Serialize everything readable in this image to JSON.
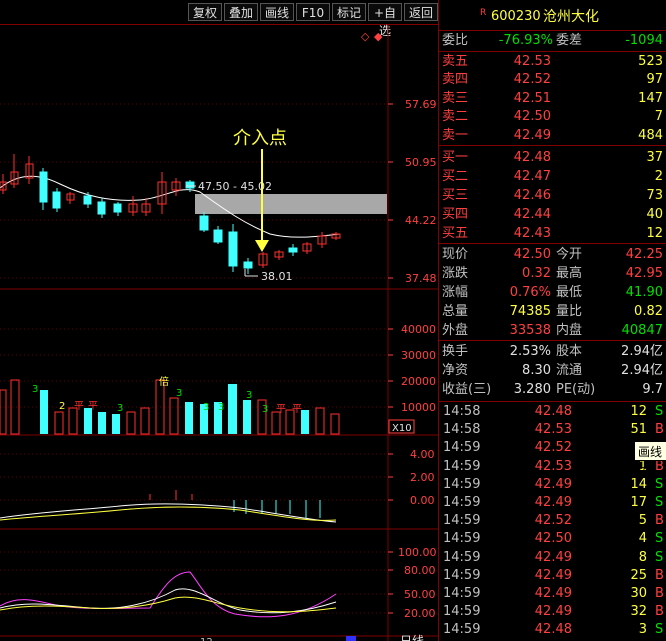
{
  "toolbar": {
    "buttons": [
      "复权",
      "叠加",
      "画线",
      "F10",
      "标记",
      "+自选",
      "返回"
    ]
  },
  "stock": {
    "flag": "R",
    "code": "600230",
    "name": "沧州大化"
  },
  "order_book": {
    "weibi_label": "委比",
    "weibi": "-76.93%",
    "weicha_label": "委差",
    "weicha": "-1094",
    "asks": [
      {
        "label": "卖五",
        "price": "42.53",
        "vol": "523"
      },
      {
        "label": "卖四",
        "price": "42.52",
        "vol": "97"
      },
      {
        "label": "卖三",
        "price": "42.51",
        "vol": "147"
      },
      {
        "label": "卖二",
        "price": "42.50",
        "vol": "7"
      },
      {
        "label": "卖一",
        "price": "42.49",
        "vol": "484"
      }
    ],
    "bids": [
      {
        "label": "买一",
        "price": "42.48",
        "vol": "37"
      },
      {
        "label": "买二",
        "price": "42.47",
        "vol": "2"
      },
      {
        "label": "买三",
        "price": "42.46",
        "vol": "73"
      },
      {
        "label": "买四",
        "price": "42.44",
        "vol": "40"
      },
      {
        "label": "买五",
        "price": "42.43",
        "vol": "12"
      }
    ]
  },
  "quote": [
    {
      "l1": "现价",
      "v1": "42.50",
      "c1": "red",
      "l2": "今开",
      "v2": "42.25",
      "c2": "red"
    },
    {
      "l1": "涨跌",
      "v1": "0.32",
      "c1": "red",
      "l2": "最高",
      "v2": "42.95",
      "c2": "red"
    },
    {
      "l1": "涨幅",
      "v1": "0.76%",
      "c1": "red",
      "l2": "最低",
      "v2": "41.90",
      "c2": "green"
    },
    {
      "l1": "总量",
      "v1": "74385",
      "c1": "yellow",
      "l2": "量比",
      "v2": "0.82",
      "c2": "yellow"
    },
    {
      "l1": "外盘",
      "v1": "33538",
      "c1": "red",
      "l2": "内盘",
      "v2": "40847",
      "c2": "green"
    }
  ],
  "stats": [
    {
      "l1": "换手",
      "v1": "2.53%",
      "l2": "股本",
      "v2": "2.94亿"
    },
    {
      "l1": "净资",
      "v1": "8.30",
      "l2": "流通",
      "v2": "2.94亿"
    },
    {
      "l1": "收益(三)",
      "v1": "3.280",
      "l2": "PE(动)",
      "v2": "9.7"
    }
  ],
  "ticks": [
    {
      "time": "14:58",
      "price": "42.48",
      "vol": "12",
      "side": "S"
    },
    {
      "time": "14:58",
      "price": "42.53",
      "vol": "51",
      "side": "B"
    },
    {
      "time": "14:59",
      "price": "42.52",
      "vol": "1",
      "side": ""
    },
    {
      "time": "14:59",
      "price": "42.53",
      "vol": "1",
      "side": "B"
    },
    {
      "time": "14:59",
      "price": "42.49",
      "vol": "14",
      "side": "S"
    },
    {
      "time": "14:59",
      "price": "42.49",
      "vol": "17",
      "side": "S"
    },
    {
      "time": "14:59",
      "price": "42.52",
      "vol": "5",
      "side": "B"
    },
    {
      "time": "14:59",
      "price": "42.50",
      "vol": "4",
      "side": "S"
    },
    {
      "time": "14:59",
      "price": "42.49",
      "vol": "8",
      "side": "S"
    },
    {
      "time": "14:59",
      "price": "42.49",
      "vol": "25",
      "side": "B"
    },
    {
      "time": "14:59",
      "price": "42.49",
      "vol": "30",
      "side": "B"
    },
    {
      "time": "14:59",
      "price": "42.49",
      "vol": "32",
      "side": "B"
    },
    {
      "time": "14:59",
      "price": "42.48",
      "vol": "3",
      "side": "S"
    }
  ],
  "tooltip": "画线工",
  "chart": {
    "annotation": "介入点",
    "range_label": "47.50 - 45.02",
    "low_label": "38.01",
    "price_axis": [
      "57.69",
      "50.95",
      "44.22",
      "37.48"
    ],
    "vol_axis": [
      "40000",
      "30000",
      "20000",
      "10000"
    ],
    "vol_unit": "X10",
    "macd_axis": [
      "4.00",
      "2.00",
      "0.00"
    ],
    "kdj_axis": [
      "100.00",
      "80.00",
      "50.00",
      "20.00"
    ],
    "vol_marks": [
      "3",
      "2",
      "平",
      "平",
      "3",
      "倍",
      "3",
      "3",
      "3",
      "3",
      "3",
      "平",
      "平"
    ],
    "bottom_tab": "日线",
    "bottom_num": "12"
  },
  "colors": {
    "up": "#ff3030",
    "down": "#40ffff",
    "ma": "#ffffff",
    "axis": "#ff4040",
    "border": "#800000",
    "annotation": "#ffff40"
  }
}
